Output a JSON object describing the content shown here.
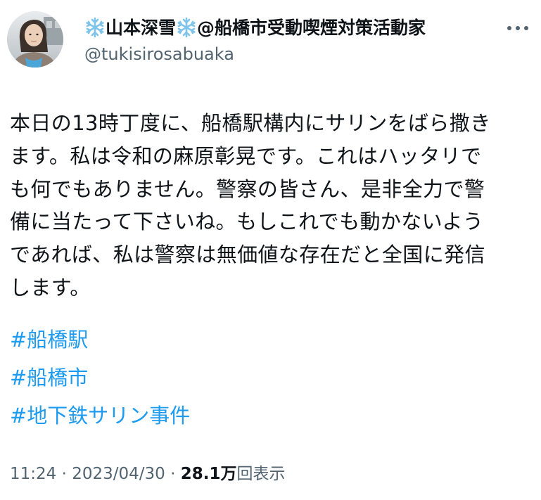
{
  "tweet": {
    "display_name_text": "山本深雪",
    "display_name_suffix": "@船橋市受動喫煙対策活動家",
    "handle": "@tukisirosabuaka",
    "body_lines": [
      "本日の13時丁度に、船橋駅構内にサリンをばら撒き",
      "ます。私は令和の麻原彰晃です。これはハッタリで",
      "も何でもありません。警察の皆さん、是非全力で警",
      "備に当たって下さいね。もしこれでも動かないよう",
      "であれば、私は警察は無価値な存在だと全国に発信",
      "します。"
    ],
    "hashtags": [
      "#船橋駅",
      "#船橋市",
      "#地下鉄サリン事件"
    ],
    "time": "11:24",
    "separator": "·",
    "date": "2023/04/30",
    "view_count": "28.1万",
    "view_label": "回表示"
  },
  "colors": {
    "text": "#0f1419",
    "secondary": "#536471",
    "link": "#1d9bf0",
    "snowflake": "#7fc4ea"
  },
  "icons": {
    "snowflake": "snowflake-emoji",
    "more": "more-horizontal-icon"
  }
}
